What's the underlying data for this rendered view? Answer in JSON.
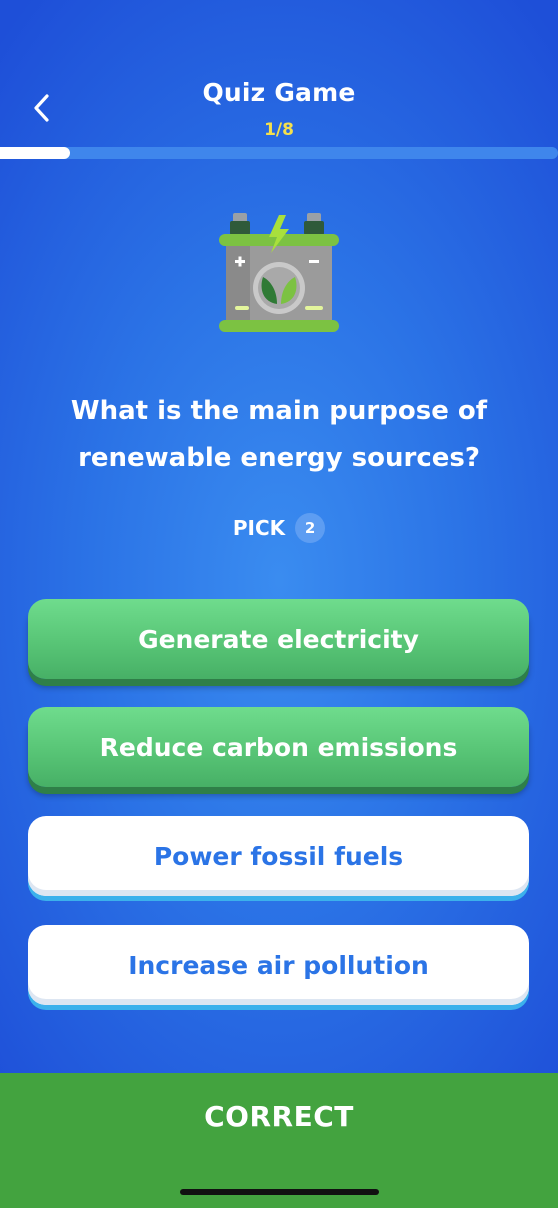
{
  "header": {
    "title": "Quiz Game",
    "counter": "1/8",
    "progress_fraction": 0.125
  },
  "illustration": {
    "icon": "battery-leaf-icon"
  },
  "question": {
    "text": "What is the main purpose of renewable energy sources?",
    "pick_label": "PICK",
    "pick_count": "2"
  },
  "answers": [
    {
      "label": "Generate electricity",
      "selected": true
    },
    {
      "label": "Reduce carbon emissions",
      "selected": true
    },
    {
      "label": "Power fossil fuels",
      "selected": false
    },
    {
      "label": "Increase air pollution",
      "selected": false
    }
  ],
  "footer": {
    "result": "CORRECT"
  },
  "colors": {
    "background": "#2b73e6",
    "accent_yellow": "#f4e04d",
    "selected_green": "#58c576",
    "unselected_text": "#2b74e6",
    "footer_green": "#43a33f"
  }
}
